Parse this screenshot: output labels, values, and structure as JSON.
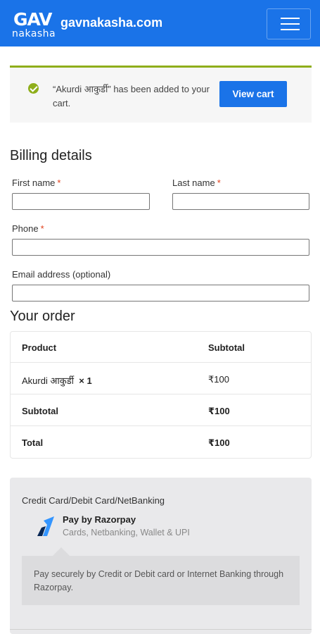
{
  "header": {
    "logo_main": "GAV",
    "logo_sub": "nakasha",
    "site_name": "gavnakasha.com",
    "menu_icon": "hamburger-icon",
    "brand_color": "#1a73e8"
  },
  "notice": {
    "text": "“Akurdi आकुर्डी” has been added to your cart.",
    "button_label": "View cart",
    "icon": "check-circle-icon",
    "accent_color": "#8fae1b"
  },
  "billing": {
    "title": "Billing details",
    "required_mark": "*",
    "first_name": {
      "label": "First name",
      "value": ""
    },
    "last_name": {
      "label": "Last name",
      "value": ""
    },
    "phone": {
      "label": "Phone",
      "value": ""
    },
    "email": {
      "label": "Email address (optional)",
      "value": ""
    }
  },
  "order": {
    "title": "Your order",
    "headers": [
      "Product",
      "Subtotal"
    ],
    "rows": [
      {
        "product": "Akurdi आकुर्डी",
        "qty": "× 1",
        "subtotal": "₹100"
      }
    ],
    "subtotal_label": "Subtotal",
    "subtotal_value": "₹100",
    "total_label": "Total",
    "total_value": "₹100"
  },
  "payment": {
    "method_label": "Credit Card/Debit Card/NetBanking",
    "provider_title": "Pay by Razorpay",
    "provider_subtitle": "Cards, Netbanking, Wallet & UPI",
    "provider_icon": "razorpay-logo-icon",
    "description": "Pay securely by Credit or Debit card or Internet Banking through Razorpay."
  }
}
